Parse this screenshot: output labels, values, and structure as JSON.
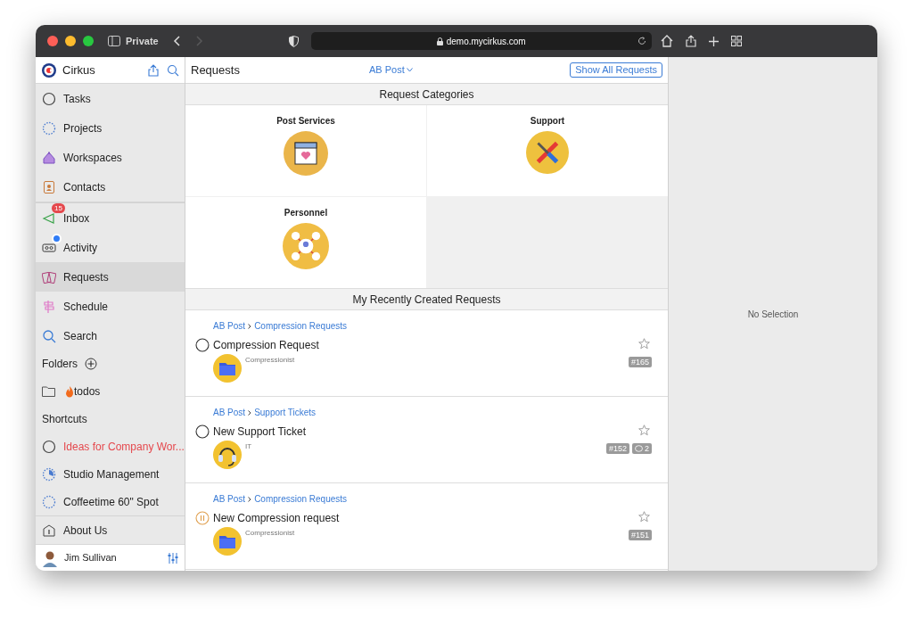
{
  "browser": {
    "mode_label": "Private",
    "url": "demo.mycirkus.com",
    "back_enabled": true,
    "forward_enabled": false
  },
  "sidebar": {
    "app_name": "Cirkus",
    "nav": [
      {
        "label": "Tasks",
        "kind": "tasks",
        "selected": false
      },
      {
        "label": "Projects",
        "kind": "projects",
        "selected": false
      },
      {
        "label": "Workspaces",
        "kind": "workspaces",
        "selected": false
      },
      {
        "label": "Contacts",
        "kind": "contacts",
        "selected": false
      },
      {
        "label": "Inbox",
        "kind": "inbox",
        "selected": false,
        "badge": "15"
      },
      {
        "label": "Activity",
        "kind": "activity",
        "selected": false,
        "dot": true
      },
      {
        "label": "Requests",
        "kind": "requests",
        "selected": true
      },
      {
        "label": "Schedule",
        "kind": "schedule",
        "selected": false
      },
      {
        "label": "Search",
        "kind": "search",
        "selected": false
      }
    ],
    "folders_title": "Folders",
    "folders": [
      {
        "label": "todos"
      }
    ],
    "shortcuts_title": "Shortcuts",
    "shortcuts": [
      {
        "label": "Ideas for Company Wor...",
        "kind": "task",
        "color": "#e5484d"
      },
      {
        "label": "Studio Management",
        "kind": "project-progress",
        "color": "#222222"
      },
      {
        "label": "Coffeetime 60\" Spot",
        "kind": "project",
        "color": "#222222"
      },
      {
        "label": "About Us",
        "kind": "info",
        "color": "#222222"
      }
    ],
    "user": {
      "name": "Jim Sullivan"
    }
  },
  "main": {
    "title": "Requests",
    "workspace": "AB Post",
    "show_all_button": "Show All Requests",
    "categories_title": "Request Categories",
    "categories": [
      {
        "name": "Post Services",
        "kind": "store"
      },
      {
        "name": "Support",
        "kind": "tools"
      },
      {
        "name": "Personnel",
        "kind": "people"
      }
    ],
    "recent_title": "My Recently Created Requests",
    "requests": [
      {
        "workspace": "AB Post",
        "category": "Compression Requests",
        "title": "Compression Request",
        "paused": false,
        "assignee": "Compressionist",
        "kind": "folder",
        "starred": false,
        "number": "#165"
      },
      {
        "workspace": "AB Post",
        "category": "Support Tickets",
        "title": "New Support Ticket",
        "paused": false,
        "assignee": "IT",
        "kind": "headset",
        "starred": false,
        "number": "#152",
        "comments": "2"
      },
      {
        "workspace": "AB Post",
        "category": "Compression Requests",
        "title": "New Compression request",
        "paused": true,
        "assignee": "Compressionist",
        "kind": "folder",
        "starred": false,
        "number": "#151"
      }
    ]
  },
  "detail": {
    "empty_text": "No Selection"
  }
}
